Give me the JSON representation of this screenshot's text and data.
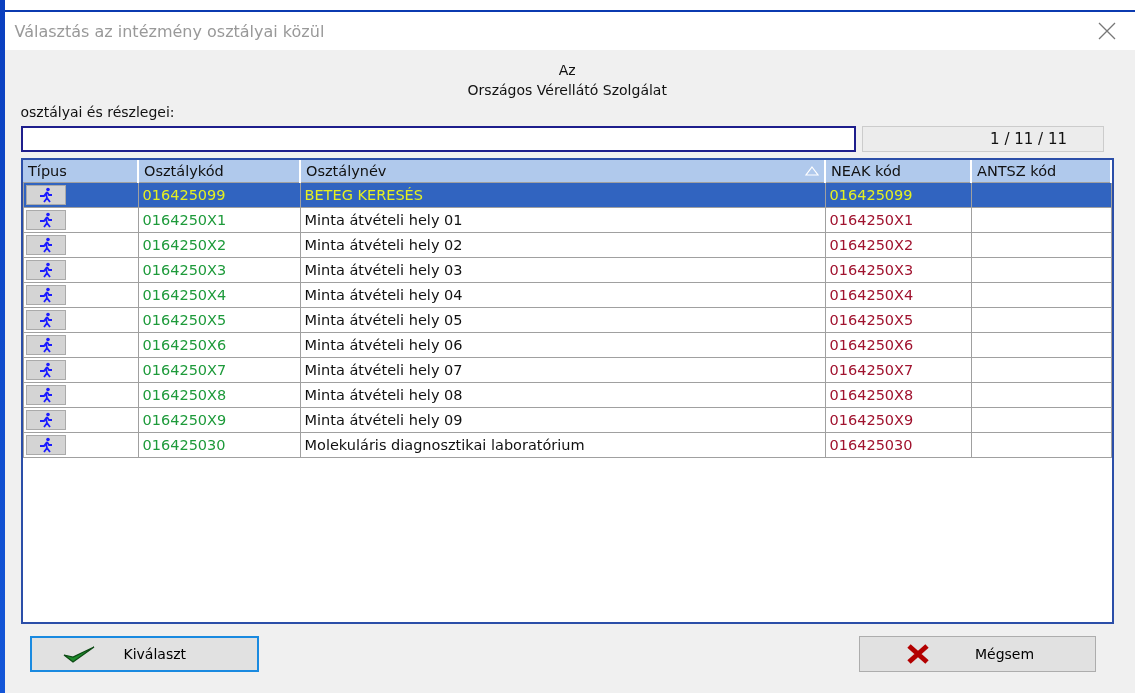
{
  "window": {
    "title": "Választás az intézmény osztályai közül"
  },
  "heading": {
    "line_1": "Az",
    "line_2": "Országos Vérellátó Szolgálat"
  },
  "list_label": "osztályai és részlegei:",
  "counter": "1 / 11 / 11",
  "table": {
    "columns": [
      {
        "label": "Típus",
        "sorted": false
      },
      {
        "label": "Osztálykód",
        "sorted": false
      },
      {
        "label": "Osztálynév",
        "sorted": true
      },
      {
        "label": "NEAK kód",
        "sorted": false
      },
      {
        "label": "ANTSZ kód",
        "sorted": false
      }
    ],
    "rows": [
      {
        "code": "016425099",
        "name": "BETEG KERESÉS",
        "neak": "016425099",
        "selected": true
      },
      {
        "code": "0164250X1",
        "name": "Minta átvételi hely 01",
        "neak": "0164250X1",
        "selected": false
      },
      {
        "code": "0164250X2",
        "name": "Minta átvételi hely 02",
        "neak": "0164250X2",
        "selected": false
      },
      {
        "code": "0164250X3",
        "name": "Minta átvételi hely 03",
        "neak": "0164250X3",
        "selected": false
      },
      {
        "code": "0164250X4",
        "name": "Minta átvételi hely 04",
        "neak": "0164250X4",
        "selected": false
      },
      {
        "code": "0164250X5",
        "name": "Minta átvételi hely 05",
        "neak": "0164250X5",
        "selected": false
      },
      {
        "code": "0164250X6",
        "name": "Minta átvételi hely 06",
        "neak": "0164250X6",
        "selected": false
      },
      {
        "code": "0164250X7",
        "name": "Minta átvételi hely 07",
        "neak": "0164250X7",
        "selected": false
      },
      {
        "code": "0164250X8",
        "name": "Minta átvételi hely 08",
        "neak": "0164250X8",
        "selected": false
      },
      {
        "code": "0164250X9",
        "name": "Minta átvételi hely 09",
        "neak": "0164250X9",
        "selected": false
      },
      {
        "code": "016425030",
        "name": "Molekuláris diagnosztikai laboratórium",
        "neak": "016425030",
        "selected": false
      }
    ]
  },
  "buttons": [
    {
      "label": "Kiválaszt",
      "kind": "ok"
    },
    {
      "label": "Mégsem",
      "kind": "cancel"
    }
  ]
}
